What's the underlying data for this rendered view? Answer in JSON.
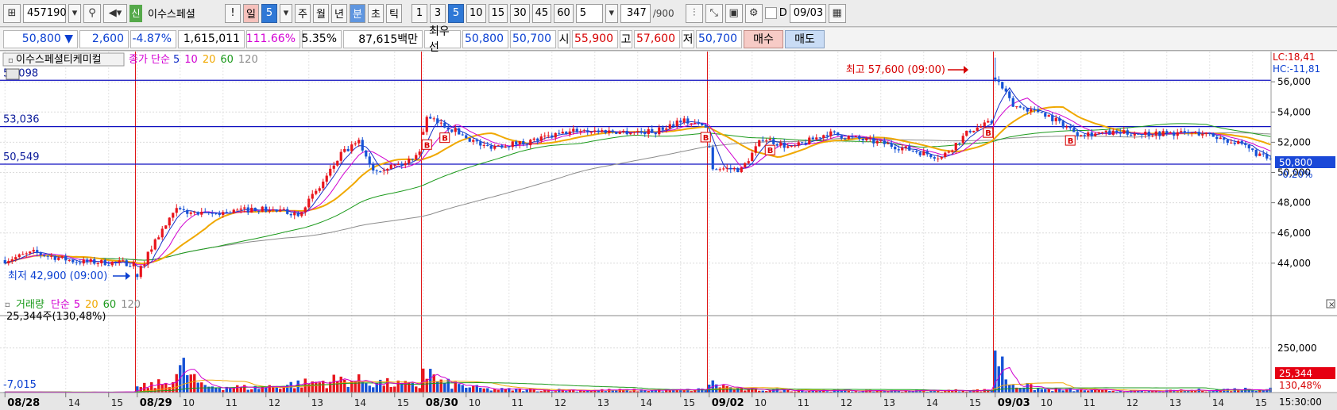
{
  "toolbar": {
    "code": "457190",
    "market_tag": "신",
    "stock_name": "이수스페셜",
    "alert_label": "!",
    "periods": [
      "일",
      "5",
      "주",
      "월",
      "년",
      "분",
      "초",
      "틱"
    ],
    "active_period": "분",
    "intervals": [
      "1",
      "3",
      "5",
      "10",
      "15",
      "30",
      "45",
      "60"
    ],
    "active_interval": "5",
    "count_select": "5",
    "bars_shown": "347",
    "bars_total": "/900",
    "d_label": "D",
    "date": "09/03"
  },
  "quote": {
    "price": "50,800 ▼",
    "change": "2,600",
    "change_pct": "-4.87%",
    "volume": "1,615,011",
    "vol_ratio": "111.66%",
    "turnover_pct": "5.35%",
    "amount": "87,615백만",
    "best_label": "최우선",
    "ask": "50,800",
    "bid": "50,700",
    "open_label": "시",
    "open": "55,900",
    "high_label": "고",
    "high": "57,600",
    "low_label": "저",
    "low": "50,700",
    "buy_label": "매수",
    "sell_label": "매도"
  },
  "price_legend": {
    "name": "이수스페셜티케미컬",
    "indicator": "종가 단순",
    "periods": [
      "5",
      "10",
      "20",
      "60",
      "120"
    ]
  },
  "volume_legend": {
    "name": "거래량",
    "indicator": "단순",
    "periods": [
      "5",
      "20",
      "60",
      "120"
    ],
    "current": "25,344주(130,48%)",
    "level_label": "-7,015"
  },
  "annotations": {
    "high": "최고 57,600 (09:00)",
    "low": "최저 42,900 (09:00)",
    "lc": "LC:18,41",
    "hc": "HC:-11,81",
    "price_tag": "50,800",
    "price_tag_pct": "-0.20%",
    "vol_tag": "25,344",
    "vol_tag_pct": "130,48%"
  },
  "colors": {
    "up": "#e8141c",
    "down": "#1652d6",
    "ma5": "#1530c8",
    "ma10": "#d000d0",
    "ma20": "#f0a800",
    "ma60": "#1c9a1c",
    "ma120": "#8c8c8c",
    "hline": "#1010c0",
    "session": "#e01818"
  },
  "chart_data": {
    "type": "candlestick",
    "ylim": [
      42000,
      58000
    ],
    "y_ticks": [
      "56,000",
      "54,000",
      "52,000",
      "50,000",
      "48,000",
      "46,000",
      "44,000"
    ],
    "h_lines": [
      {
        "label": "5?,098",
        "value": 56098
      },
      {
        "label": "53,036",
        "value": 53036
      },
      {
        "label": "50,549",
        "value": 50549
      }
    ],
    "volume_ylim": [
      0,
      400000
    ],
    "volume_ticks": [
      "250,000"
    ],
    "x_labels": [
      {
        "t": "08/28",
        "i": 0,
        "bold": true
      },
      {
        "t": "14",
        "i": 17
      },
      {
        "t": "15",
        "i": 29
      },
      {
        "t": "08/29",
        "i": 37,
        "bold": true
      },
      {
        "t": "10",
        "i": 49
      },
      {
        "t": "11",
        "i": 61
      },
      {
        "t": "12",
        "i": 73
      },
      {
        "t": "13",
        "i": 85
      },
      {
        "t": "14",
        "i": 97
      },
      {
        "t": "15",
        "i": 109
      },
      {
        "t": "08/30",
        "i": 117,
        "bold": true
      },
      {
        "t": "10",
        "i": 129
      },
      {
        "t": "11",
        "i": 141
      },
      {
        "t": "12",
        "i": 153
      },
      {
        "t": "13",
        "i": 165
      },
      {
        "t": "14",
        "i": 177
      },
      {
        "t": "15",
        "i": 189
      },
      {
        "t": "09/02",
        "i": 197,
        "bold": true
      },
      {
        "t": "10",
        "i": 209
      },
      {
        "t": "11",
        "i": 221
      },
      {
        "t": "12",
        "i": 233
      },
      {
        "t": "13",
        "i": 245
      },
      {
        "t": "14",
        "i": 257
      },
      {
        "t": "15",
        "i": 269
      },
      {
        "t": "09/03",
        "i": 277,
        "bold": true
      },
      {
        "t": "10",
        "i": 289
      },
      {
        "t": "11",
        "i": 301
      },
      {
        "t": "12",
        "i": 313
      },
      {
        "t": "13",
        "i": 325
      },
      {
        "t": "14",
        "i": 337
      },
      {
        "t": "15",
        "i": 349
      }
    ],
    "session_starts": [
      37,
      117,
      197,
      277
    ],
    "last_time": "15:30:00",
    "n_bars": 355,
    "price_keyframes": [
      [
        0,
        44200
      ],
      [
        8,
        44700
      ],
      [
        20,
        44100
      ],
      [
        36,
        44000
      ],
      [
        37,
        43200
      ],
      [
        42,
        45500
      ],
      [
        48,
        47500
      ],
      [
        55,
        47200
      ],
      [
        70,
        47600
      ],
      [
        82,
        47300
      ],
      [
        88,
        49000
      ],
      [
        94,
        51200
      ],
      [
        99,
        52000
      ],
      [
        103,
        50200
      ],
      [
        112,
        50600
      ],
      [
        116,
        51500
      ],
      [
        118,
        53600
      ],
      [
        124,
        53000
      ],
      [
        134,
        51700
      ],
      [
        146,
        52000
      ],
      [
        160,
        52800
      ],
      [
        172,
        52700
      ],
      [
        182,
        52700
      ],
      [
        189,
        53500
      ],
      [
        196,
        53000
      ],
      [
        198,
        50300
      ],
      [
        206,
        50200
      ],
      [
        212,
        52300
      ],
      [
        220,
        51600
      ],
      [
        230,
        52600
      ],
      [
        246,
        51900
      ],
      [
        262,
        51000
      ],
      [
        270,
        52800
      ],
      [
        276,
        53300
      ],
      [
        277,
        56300
      ],
      [
        282,
        54400
      ],
      [
        290,
        54000
      ],
      [
        300,
        52600
      ],
      [
        320,
        52600
      ],
      [
        335,
        52600
      ],
      [
        344,
        52000
      ],
      [
        354,
        50800
      ]
    ],
    "volume_keyframes": [
      [
        0,
        3000
      ],
      [
        36,
        3000
      ],
      [
        37,
        30000
      ],
      [
        45,
        60000
      ],
      [
        50,
        150000
      ],
      [
        55,
        40000
      ],
      [
        70,
        30000
      ],
      [
        85,
        60000
      ],
      [
        95,
        80000
      ],
      [
        105,
        60000
      ],
      [
        116,
        40000
      ],
      [
        117,
        150000
      ],
      [
        122,
        60000
      ],
      [
        135,
        20000
      ],
      [
        160,
        15000
      ],
      [
        190,
        15000
      ],
      [
        196,
        20000
      ],
      [
        197,
        60000
      ],
      [
        205,
        20000
      ],
      [
        240,
        10000
      ],
      [
        276,
        15000
      ],
      [
        277,
        270000
      ],
      [
        281,
        60000
      ],
      [
        290,
        20000
      ],
      [
        320,
        8000
      ],
      [
        354,
        25000
      ]
    ],
    "signal_markers": [
      {
        "i": 118,
        "label": "B"
      },
      {
        "i": 123,
        "label": "B"
      },
      {
        "i": 196,
        "label": "B"
      },
      {
        "i": 214,
        "label": "B"
      },
      {
        "i": 275,
        "label": "B"
      },
      {
        "i": 298,
        "label": "B"
      }
    ]
  }
}
